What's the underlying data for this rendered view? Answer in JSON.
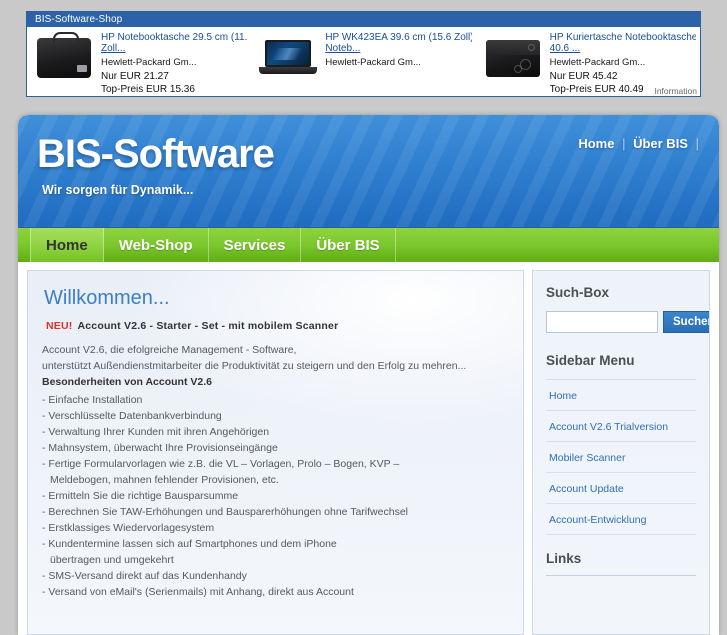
{
  "ad_banner": {
    "title": "BIS-Software-Shop",
    "info_label": "Information",
    "items": [
      {
        "thumb": "notebook-bag-photo",
        "title": "HP Notebooktasche 29.5 cm (11.6",
        "title_link": "Zoll...",
        "vendor": "Hewlett-Packard Gm...",
        "price": "Nur EUR 21.27",
        "top_price": "Top-Preis EUR 15.36"
      },
      {
        "thumb": "laptop-photo",
        "title": "HP WK423EA 39.6 cm (15.6 Zoll)",
        "title_link": "Noteb...",
        "vendor": "Hewlett-Packard Gm...",
        "price": "",
        "top_price": ""
      },
      {
        "thumb": "messenger-bag-photo",
        "title": "HP Kuriertasche Notebooktasche",
        "title_link": "40.6 ...",
        "vendor": "Hewlett-Packard Gm...",
        "price": "Nur EUR 45.42",
        "top_price": "Top-Preis EUR 40.49"
      }
    ]
  },
  "header": {
    "logo": "BIS-Software",
    "tagline": "Wir sorgen für Dynamik...",
    "top_nav": [
      {
        "label": "Home"
      },
      {
        "label": "Über BIS"
      }
    ],
    "separator": "|"
  },
  "main_menu": {
    "items": [
      {
        "label": "Home",
        "active": true
      },
      {
        "label": "Web-Shop",
        "active": false
      },
      {
        "label": "Services",
        "active": false
      },
      {
        "label": "Über BIS",
        "active": false
      }
    ]
  },
  "main": {
    "heading": "Willkommen...",
    "promo_badge": "NEU!",
    "promo_text": "Account V2.6 - Starter - Set  - mit mobilem Scanner",
    "paragraph_line1": "Account V2.6, die efolgreiche Management - Software,",
    "paragraph_line2": "unterstützt Außendienstmitarbeiter die Produktivität zu steigern und den Erfolg zu mehren...",
    "features_heading": "Besonderheiten von Account V2.6",
    "features": [
      {
        "text": "- Einfache Installation",
        "cont": ""
      },
      {
        "text": "- Verschlüsselte Datenbankverbindung",
        "cont": ""
      },
      {
        "text": "- Verwaltung Ihrer Kunden mit ihren Angehörigen",
        "cont": ""
      },
      {
        "text": "- Mahnsystem, überwacht Ihre Provisionseingänge",
        "cont": ""
      },
      {
        "text": "- Fertige Formularvorlagen wie z.B. die VL – Vorlagen, Prolo – Bogen, KVP –",
        "cont": "Meldebogen, mahnen fehlender Provisionen, etc."
      },
      {
        "text": "- Ermitteln Sie die richtige Bausparsumme",
        "cont": ""
      },
      {
        "text": "- Berechnen Sie TAW-Erhöhungen und Bausparerhöhungen ohne Tarifwechsel",
        "cont": ""
      },
      {
        "text": "- Erstklassiges Wiedervorlagesystem",
        "cont": ""
      },
      {
        "text": "- Kundentermine lassen sich auf Smartphones und dem iPhone",
        "cont": "übertragen und umgekehrt"
      },
      {
        "text": "- SMS-Versand direkt auf das Kundenhandy",
        "cont": ""
      },
      {
        "text": "- Versand von eMail's (Serienmails) mit Anhang, direkt aus Account",
        "cont": ""
      }
    ]
  },
  "sidebar": {
    "search_heading": "Such-Box",
    "search_value": "",
    "search_placeholder": "",
    "search_button": "Suchen",
    "menu_heading": "Sidebar Menu",
    "menu_items": [
      {
        "label": "Home"
      },
      {
        "label": "Account V2.6 Trialversion"
      },
      {
        "label": "Mobiler Scanner"
      },
      {
        "label": "Account Update"
      },
      {
        "label": "Account-Entwicklung"
      }
    ],
    "links_heading": "Links"
  },
  "colors": {
    "header_blue": "#2f7fd0",
    "menu_green": "#7cc72d",
    "accent_link": "#2f6fb8",
    "promo_red": "#e03024",
    "ad_title_blue": "#2b62a8"
  }
}
